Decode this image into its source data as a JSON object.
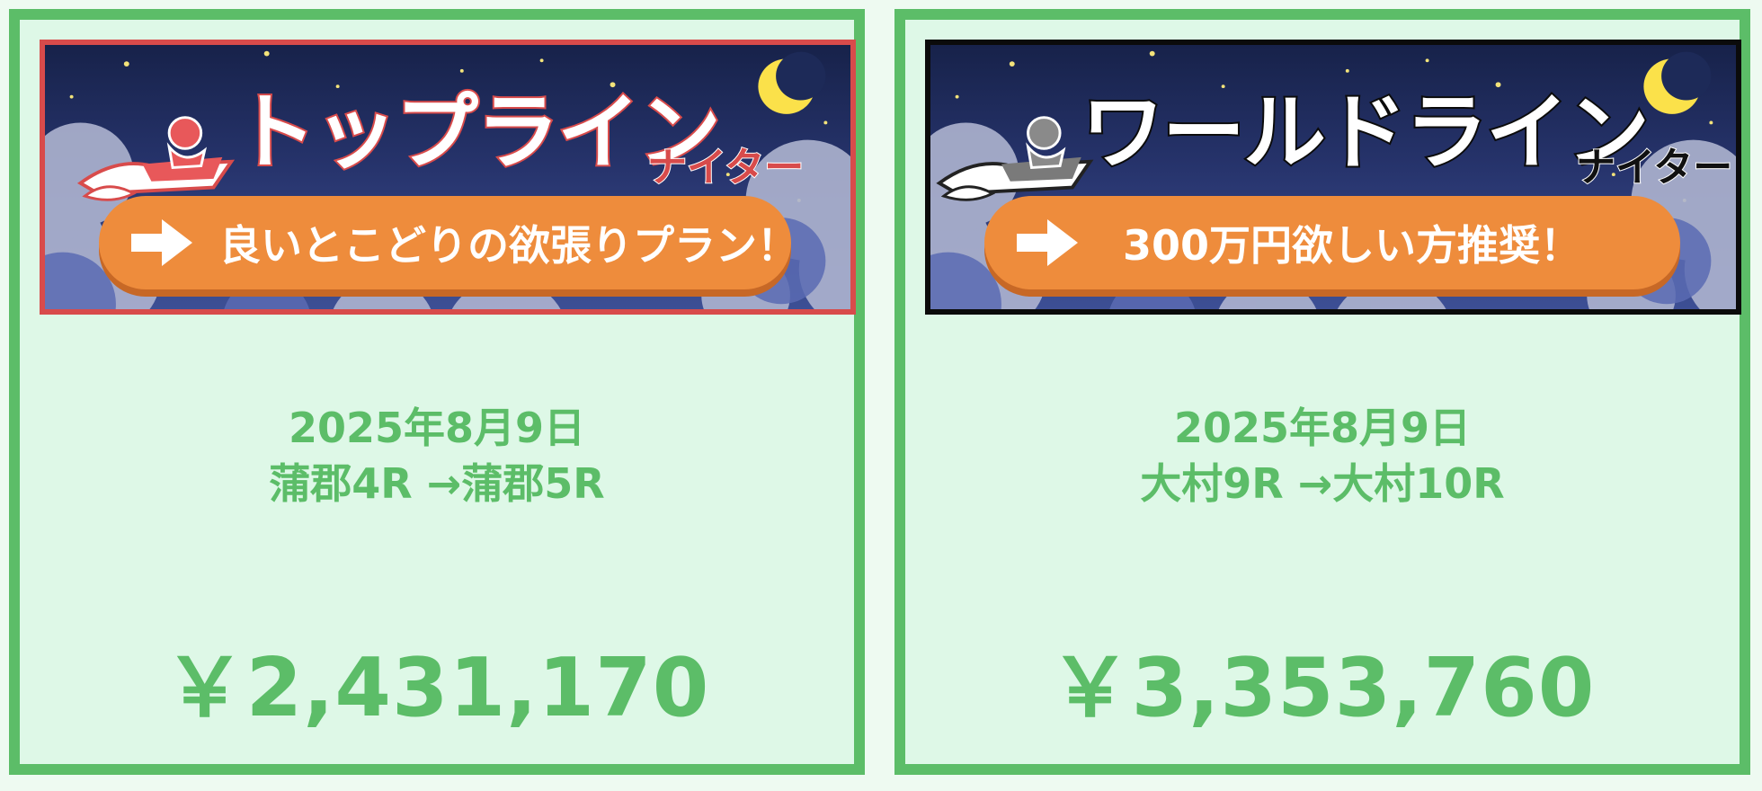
{
  "cards": [
    {
      "banner": {
        "title": "トップライン",
        "subtitle": "ナイター",
        "cta_label": "良いとこどりの欲張りプラン！"
      },
      "date": "2025年8月9日",
      "route": "蒲郡4R →蒲郡5R",
      "amount": "￥2,431,170"
    },
    {
      "banner": {
        "title": "ワールドライン",
        "subtitle": "ナイター",
        "cta_label": "300万円欲しい方推奨！"
      },
      "date": "2025年8月9日",
      "route": "大村9R →大村10R",
      "amount": "￥3,353,760"
    }
  ],
  "colors": {
    "accent_green": "#5cbd68",
    "card_bg": "#def8e7",
    "cta_orange": "#ee8c3c",
    "left_banner_border": "#d84b4b",
    "right_banner_border": "#0b0b0b",
    "night_sky": "#17224a"
  },
  "icons": {
    "cta_icon": "right-arrow-icon",
    "moon": "crescent-moon-icon",
    "boat": "racing-boat-icon"
  }
}
